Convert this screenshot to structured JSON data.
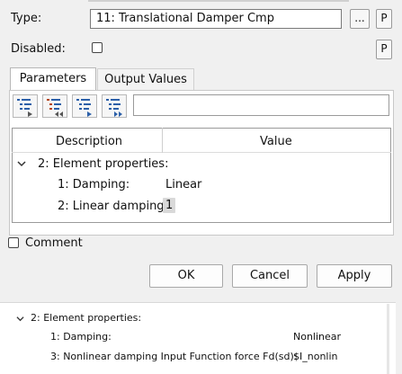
{
  "form": {
    "type_label": "Type:",
    "type_value": "11: Translational Damper Cmp",
    "browse_button": "...",
    "p_button": "P",
    "disabled_label": "Disabled:"
  },
  "tabs": [
    {
      "label": "Parameters",
      "active": true
    },
    {
      "label": "Output Values",
      "active": false
    }
  ],
  "grid": {
    "headers": {
      "description": "Description",
      "value": "Value"
    },
    "group": "2: Element properties:",
    "rows": [
      {
        "desc": "1: Damping:",
        "value": "Linear"
      },
      {
        "desc": "2: Linear damping:",
        "value": "1"
      }
    ]
  },
  "comment_label": "Comment",
  "buttons": {
    "ok": "OK",
    "cancel": "Cancel",
    "apply": "Apply"
  },
  "snippet": {
    "group": "2: Element properties:",
    "rows": [
      {
        "desc": "1: Damping:",
        "value": "Nonlinear"
      },
      {
        "desc": "3: Nonlinear damping Input Function force Fd(sd):",
        "value": "$I_nonlin"
      }
    ]
  }
}
